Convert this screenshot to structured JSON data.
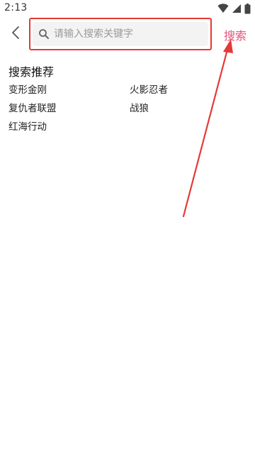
{
  "status_bar": {
    "time": "2:13",
    "icons": [
      "wifi-icon",
      "signal-icon",
      "battery-icon"
    ]
  },
  "header": {
    "back_icon": "chevron-left-icon",
    "search_icon": "search-icon",
    "search_placeholder": "请输入搜索关键字",
    "search_value": "",
    "search_button_label": "搜索"
  },
  "recommendations": {
    "title": "搜索推荐",
    "items": [
      {
        "label": "变形金刚"
      },
      {
        "label": "火影忍者"
      },
      {
        "label": "复仇者联盟"
      },
      {
        "label": "战狼"
      },
      {
        "label": "红海行动"
      }
    ]
  },
  "colors": {
    "accent": "#e8507a",
    "highlight": "#e53935",
    "search_bg": "#f3f3f3"
  }
}
